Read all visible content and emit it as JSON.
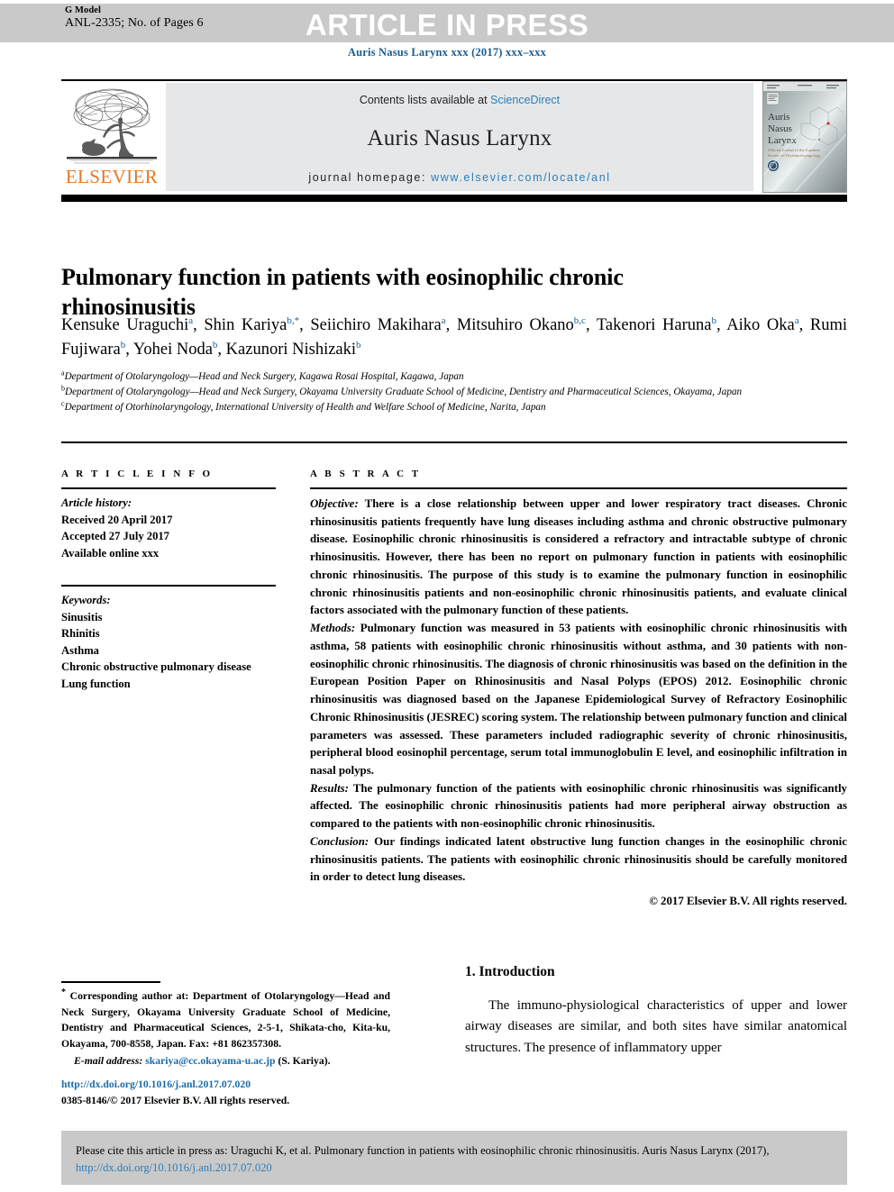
{
  "banner": {
    "g_model_label": "G Model",
    "manuscript_id": "ANL-2335; No. of Pages 6",
    "article_in_press": "ARTICLE IN PRESS"
  },
  "journal_cite": "Auris Nasus Larynx xxx (2017) xxx–xxx",
  "masthead": {
    "publisher_name": "ELSEVIER",
    "publisher_logo_icon": "elsevier-tree-logo",
    "contents_prefix": "Contents lists available at ",
    "contents_link": "ScienceDirect",
    "journal_title": "Auris Nasus Larynx",
    "homepage_prefix": "journal homepage: ",
    "homepage_link": "www.elsevier.com/locate/anl",
    "cover_thumbnail_icon": "journal-cover-thumbnail",
    "cover_title_line1": "Auris",
    "cover_title_line2": "Nasus",
    "cover_title_line3": "Larynx"
  },
  "article": {
    "title": "Pulmonary function in patients with eosinophilic chronic rhinosinusitis",
    "authors": [
      {
        "name": "Kensuke Uraguchi",
        "sup": "a",
        "sep": ", "
      },
      {
        "name": "Shin Kariya",
        "sup": "b,*",
        "sep": ", "
      },
      {
        "name": "Seiichiro Makihara",
        "sup": "a",
        "sep": ", "
      },
      {
        "name": "Mitsuhiro Okano",
        "sup": "b,c",
        "sep": ", "
      },
      {
        "name": "Takenori Haruna",
        "sup": "b",
        "sep": ", "
      },
      {
        "name": "Aiko Oka",
        "sup": "a",
        "sep": ", "
      },
      {
        "name": "Rumi Fujiwara",
        "sup": "b",
        "sep": ", "
      },
      {
        "name": "Yohei Noda",
        "sup": "b",
        "sep": ", "
      },
      {
        "name": "Kazunori Nishizaki",
        "sup": "b",
        "sep": ""
      }
    ],
    "affiliations": [
      {
        "marker": "a",
        "text": "Department of Otolaryngology—Head and Neck Surgery, Kagawa Rosai Hospital, Kagawa, Japan"
      },
      {
        "marker": "b",
        "text": "Department of Otolaryngology—Head and Neck Surgery, Okayama University Graduate School of Medicine, Dentistry and Pharmaceutical Sciences, Okayama, Japan"
      },
      {
        "marker": "c",
        "text": "Department of Otorhinolaryngology, International University of Health and Welfare School of Medicine, Narita, Japan"
      }
    ]
  },
  "article_info": {
    "heading": "A R T I C L E   I N F O",
    "history_label": "Article history:",
    "history": [
      "Received 20 April 2017",
      "Accepted 27 July 2017",
      "Available online xxx"
    ],
    "keywords_label": "Keywords:",
    "keywords": [
      "Sinusitis",
      "Rhinitis",
      "Asthma",
      "Chronic obstructive pulmonary disease",
      "Lung function"
    ]
  },
  "abstract": {
    "heading": "A B S T R A C T",
    "sections": [
      {
        "label": "Objective:",
        "text": " There is a close relationship between upper and lower respiratory tract diseases. Chronic rhinosinusitis patients frequently have lung diseases including asthma and chronic obstructive pulmonary disease. Eosinophilic chronic rhinosinusitis is considered a refractory and intractable subtype of chronic rhinosinusitis. However, there has been no report on pulmonary function in patients with eosinophilic chronic rhinosinusitis. The purpose of this study is to examine the pulmonary function in eosinophilic chronic rhinosinusitis patients and non-eosinophilic chronic rhinosinusitis patients, and evaluate clinical factors associated with the pulmonary function of these patients."
      },
      {
        "label": "Methods:",
        "text": " Pulmonary function was measured in 53 patients with eosinophilic chronic rhinosinusitis with asthma, 58 patients with eosinophilic chronic rhinosinusitis without asthma, and 30 patients with non-eosinophilic chronic rhinosinusitis. The diagnosis of chronic rhinosinusitis was based on the definition in the European Position Paper on Rhinosinusitis and Nasal Polyps (EPOS) 2012. Eosinophilic chronic rhinosinusitis was diagnosed based on the Japanese Epidemiological Survey of Refractory Eosinophilic Chronic Rhinosinusitis (JESREC) scoring system. The relationship between pulmonary function and clinical parameters was assessed. These parameters included radiographic severity of chronic rhinosinusitis, peripheral blood eosinophil percentage, serum total immunoglobulin E level, and eosinophilic infiltration in nasal polyps."
      },
      {
        "label": "Results:",
        "text": " The pulmonary function of the patients with eosinophilic chronic rhinosinusitis was significantly affected. The eosinophilic chronic rhinosinusitis patients had more peripheral airway obstruction as compared to the patients with non-eosinophilic chronic rhinosinusitis."
      },
      {
        "label": "Conclusion:",
        "text": " Our findings indicated latent obstructive lung function changes in the eosinophilic chronic rhinosinusitis patients. The patients with eosinophilic chronic rhinosinusitis should be carefully monitored in order to detect lung diseases."
      }
    ],
    "copyright": "© 2017 Elsevier B.V. All rights reserved."
  },
  "footnote": {
    "corresponding_marker": "*",
    "corresponding_text": " Corresponding author at: Department of Otolaryngology—Head and Neck Surgery, Okayama University Graduate School of Medicine, Dentistry and Pharmaceutical Sciences, 2-5-1, Shikata-cho, Kita-ku, Okayama, 700-8558, Japan. Fax: +81 862357308.",
    "email_label": "E-mail address:",
    "email_link": "skariya@cc.okayama-u.ac.jp",
    "email_suffix": " (S. Kariya).",
    "doi_link": "http://dx.doi.org/10.1016/j.anl.2017.07.020",
    "issn_line": "0385-8146/© 2017 Elsevier B.V. All rights reserved."
  },
  "introduction": {
    "heading": "1. Introduction",
    "paragraph": "The immuno-physiological characteristics of upper and lower airway diseases are similar, and both sites have similar anatomical structures. The presence of inflammatory upper"
  },
  "citation_box": {
    "prefix": "Please cite this article in press as: Uraguchi K, et al. Pulmonary function in patients with eosinophilic chronic rhinosinusitis. Auris Nasus Larynx (2017), ",
    "link": "http://dx.doi.org/10.1016/j.anl.2017.07.020"
  },
  "colors": {
    "banner_grey": "#c9c9c9",
    "masthead_grey": "#e6e7e8",
    "link_blue": "#2a7fbb",
    "cite_blue": "#1b5d92",
    "elsevier_orange": "#e87722"
  }
}
